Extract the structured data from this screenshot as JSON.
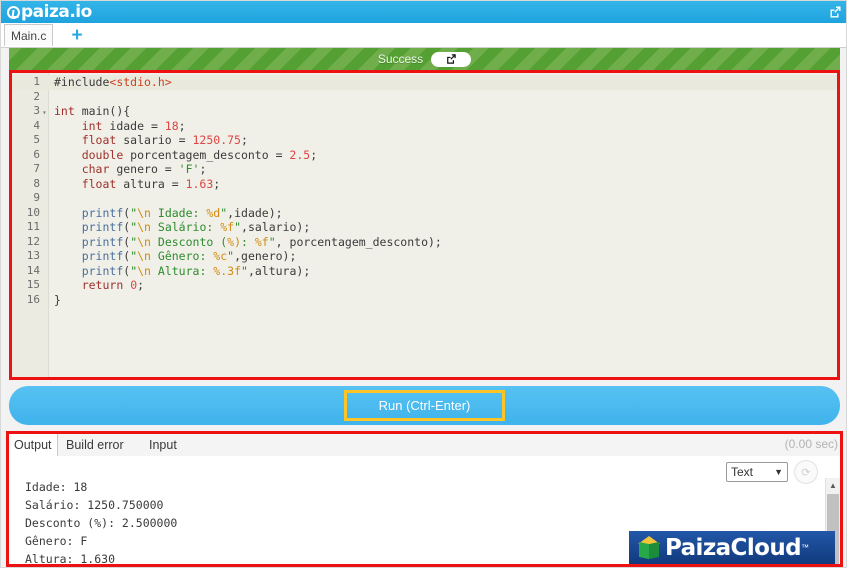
{
  "header": {
    "brand": "paiza.io",
    "brand_icon": "paiza-circle-logo",
    "external_link_icon": "external-link-icon"
  },
  "tabstrip": {
    "file_tab_label": "Main.c",
    "add_tab_label": "+",
    "add_tab_icon": "plus-icon"
  },
  "status": {
    "text": "Success",
    "button_icon": "external-link-icon"
  },
  "editor": {
    "language": "c",
    "lines": [
      {
        "num": "1",
        "fold": "",
        "tokens": [
          {
            "t": "#include",
            "c": "pp"
          },
          {
            "t": "<stdio.h>",
            "c": "inc"
          }
        ]
      },
      {
        "num": "2",
        "fold": "",
        "tokens": []
      },
      {
        "num": "3",
        "fold": "▾",
        "tokens": [
          {
            "t": "int",
            "c": "kw"
          },
          {
            "t": " ",
            "c": "pun"
          },
          {
            "t": "main",
            "c": "id"
          },
          {
            "t": "(){",
            "c": "pun"
          }
        ]
      },
      {
        "num": "4",
        "fold": "",
        "tokens": [
          {
            "t": "    ",
            "c": "pun"
          },
          {
            "t": "int",
            "c": "kw"
          },
          {
            "t": " idade = ",
            "c": "id"
          },
          {
            "t": "18",
            "c": "num-lit"
          },
          {
            "t": ";",
            "c": "pun"
          }
        ]
      },
      {
        "num": "5",
        "fold": "",
        "tokens": [
          {
            "t": "    ",
            "c": "pun"
          },
          {
            "t": "float",
            "c": "kw"
          },
          {
            "t": " salario = ",
            "c": "id"
          },
          {
            "t": "1250.75",
            "c": "num-lit"
          },
          {
            "t": ";",
            "c": "pun"
          }
        ]
      },
      {
        "num": "6",
        "fold": "",
        "tokens": [
          {
            "t": "    ",
            "c": "pun"
          },
          {
            "t": "double",
            "c": "kw"
          },
          {
            "t": " porcentagem_desconto = ",
            "c": "id"
          },
          {
            "t": "2.5",
            "c": "num-lit"
          },
          {
            "t": ";",
            "c": "pun"
          }
        ]
      },
      {
        "num": "7",
        "fold": "",
        "tokens": [
          {
            "t": "    ",
            "c": "pun"
          },
          {
            "t": "char",
            "c": "kw"
          },
          {
            "t": " genero = ",
            "c": "id"
          },
          {
            "t": "'F'",
            "c": "str"
          },
          {
            "t": ";",
            "c": "pun"
          }
        ]
      },
      {
        "num": "8",
        "fold": "",
        "tokens": [
          {
            "t": "    ",
            "c": "pun"
          },
          {
            "t": "float",
            "c": "kw"
          },
          {
            "t": " altura = ",
            "c": "id"
          },
          {
            "t": "1.63",
            "c": "num-lit"
          },
          {
            "t": ";",
            "c": "pun"
          }
        ]
      },
      {
        "num": "9",
        "fold": "",
        "tokens": []
      },
      {
        "num": "10",
        "fold": "",
        "tokens": [
          {
            "t": "    ",
            "c": "pun"
          },
          {
            "t": "printf",
            "c": "fn"
          },
          {
            "t": "(",
            "c": "pun"
          },
          {
            "t": "\"",
            "c": "str"
          },
          {
            "t": "\\n",
            "c": "esc"
          },
          {
            "t": " Idade: ",
            "c": "str"
          },
          {
            "t": "%d",
            "c": "esc"
          },
          {
            "t": "\"",
            "c": "str"
          },
          {
            "t": ",idade);",
            "c": "id"
          }
        ]
      },
      {
        "num": "11",
        "fold": "",
        "tokens": [
          {
            "t": "    ",
            "c": "pun"
          },
          {
            "t": "printf",
            "c": "fn"
          },
          {
            "t": "(",
            "c": "pun"
          },
          {
            "t": "\"",
            "c": "str"
          },
          {
            "t": "\\n",
            "c": "esc"
          },
          {
            "t": " Salário: ",
            "c": "str"
          },
          {
            "t": "%f",
            "c": "esc"
          },
          {
            "t": "\"",
            "c": "str"
          },
          {
            "t": ",salario);",
            "c": "id"
          }
        ]
      },
      {
        "num": "12",
        "fold": "",
        "tokens": [
          {
            "t": "    ",
            "c": "pun"
          },
          {
            "t": "printf",
            "c": "fn"
          },
          {
            "t": "(",
            "c": "pun"
          },
          {
            "t": "\"",
            "c": "str"
          },
          {
            "t": "\\n",
            "c": "esc"
          },
          {
            "t": " Desconto (",
            "c": "str"
          },
          {
            "t": "%)",
            "c": "esc"
          },
          {
            "t": ": ",
            "c": "str"
          },
          {
            "t": "%f",
            "c": "esc"
          },
          {
            "t": "\"",
            "c": "str"
          },
          {
            "t": ", porcentagem_desconto);",
            "c": "id"
          }
        ]
      },
      {
        "num": "13",
        "fold": "",
        "tokens": [
          {
            "t": "    ",
            "c": "pun"
          },
          {
            "t": "printf",
            "c": "fn"
          },
          {
            "t": "(",
            "c": "pun"
          },
          {
            "t": "\"",
            "c": "str"
          },
          {
            "t": "\\n",
            "c": "esc"
          },
          {
            "t": " Gênero: ",
            "c": "str"
          },
          {
            "t": "%c",
            "c": "esc"
          },
          {
            "t": "\"",
            "c": "str"
          },
          {
            "t": ",genero);",
            "c": "id"
          }
        ]
      },
      {
        "num": "14",
        "fold": "",
        "tokens": [
          {
            "t": "    ",
            "c": "pun"
          },
          {
            "t": "printf",
            "c": "fn"
          },
          {
            "t": "(",
            "c": "pun"
          },
          {
            "t": "\"",
            "c": "str"
          },
          {
            "t": "\\n",
            "c": "esc"
          },
          {
            "t": " Altura: ",
            "c": "str"
          },
          {
            "t": "%.3f",
            "c": "esc"
          },
          {
            "t": "\"",
            "c": "str"
          },
          {
            "t": ",altura);",
            "c": "id"
          }
        ]
      },
      {
        "num": "15",
        "fold": "",
        "tokens": [
          {
            "t": "    ",
            "c": "pun"
          },
          {
            "t": "return",
            "c": "kw"
          },
          {
            "t": " ",
            "c": "pun"
          },
          {
            "t": "0",
            "c": "num-lit"
          },
          {
            "t": ";",
            "c": "pun"
          }
        ]
      },
      {
        "num": "16",
        "fold": "",
        "tokens": [
          {
            "t": "}",
            "c": "pun"
          }
        ]
      }
    ]
  },
  "run": {
    "label": "Run (Ctrl-Enter)"
  },
  "output": {
    "tabs": [
      {
        "label": "Output",
        "active": true
      },
      {
        "label": "Build error",
        "active": false
      },
      {
        "label": "Input",
        "active": false
      }
    ],
    "time": "(0.00 sec)",
    "format_select": "Text",
    "chevron_icon": "chevron-down-icon",
    "refresh_icon": "refresh-icon",
    "scroll_up_icon": "triangle-up-icon",
    "scroll_down_icon": "triangle-down-icon",
    "text": "Idade: 18\nSalário: 1250.750000\nDesconto (%): 2.500000\nGênero: F\nAltura: 1.630"
  },
  "watermark": {
    "text": "PaizaCloud",
    "tm": "™",
    "icon": "cube-icon"
  },
  "colors": {
    "brand_blue": "#29abe2",
    "success_green": "#6ab04c",
    "annotation_red": "#ee1111",
    "run_yellow": "#ffc425",
    "logo_navy": "#1b4a96"
  }
}
